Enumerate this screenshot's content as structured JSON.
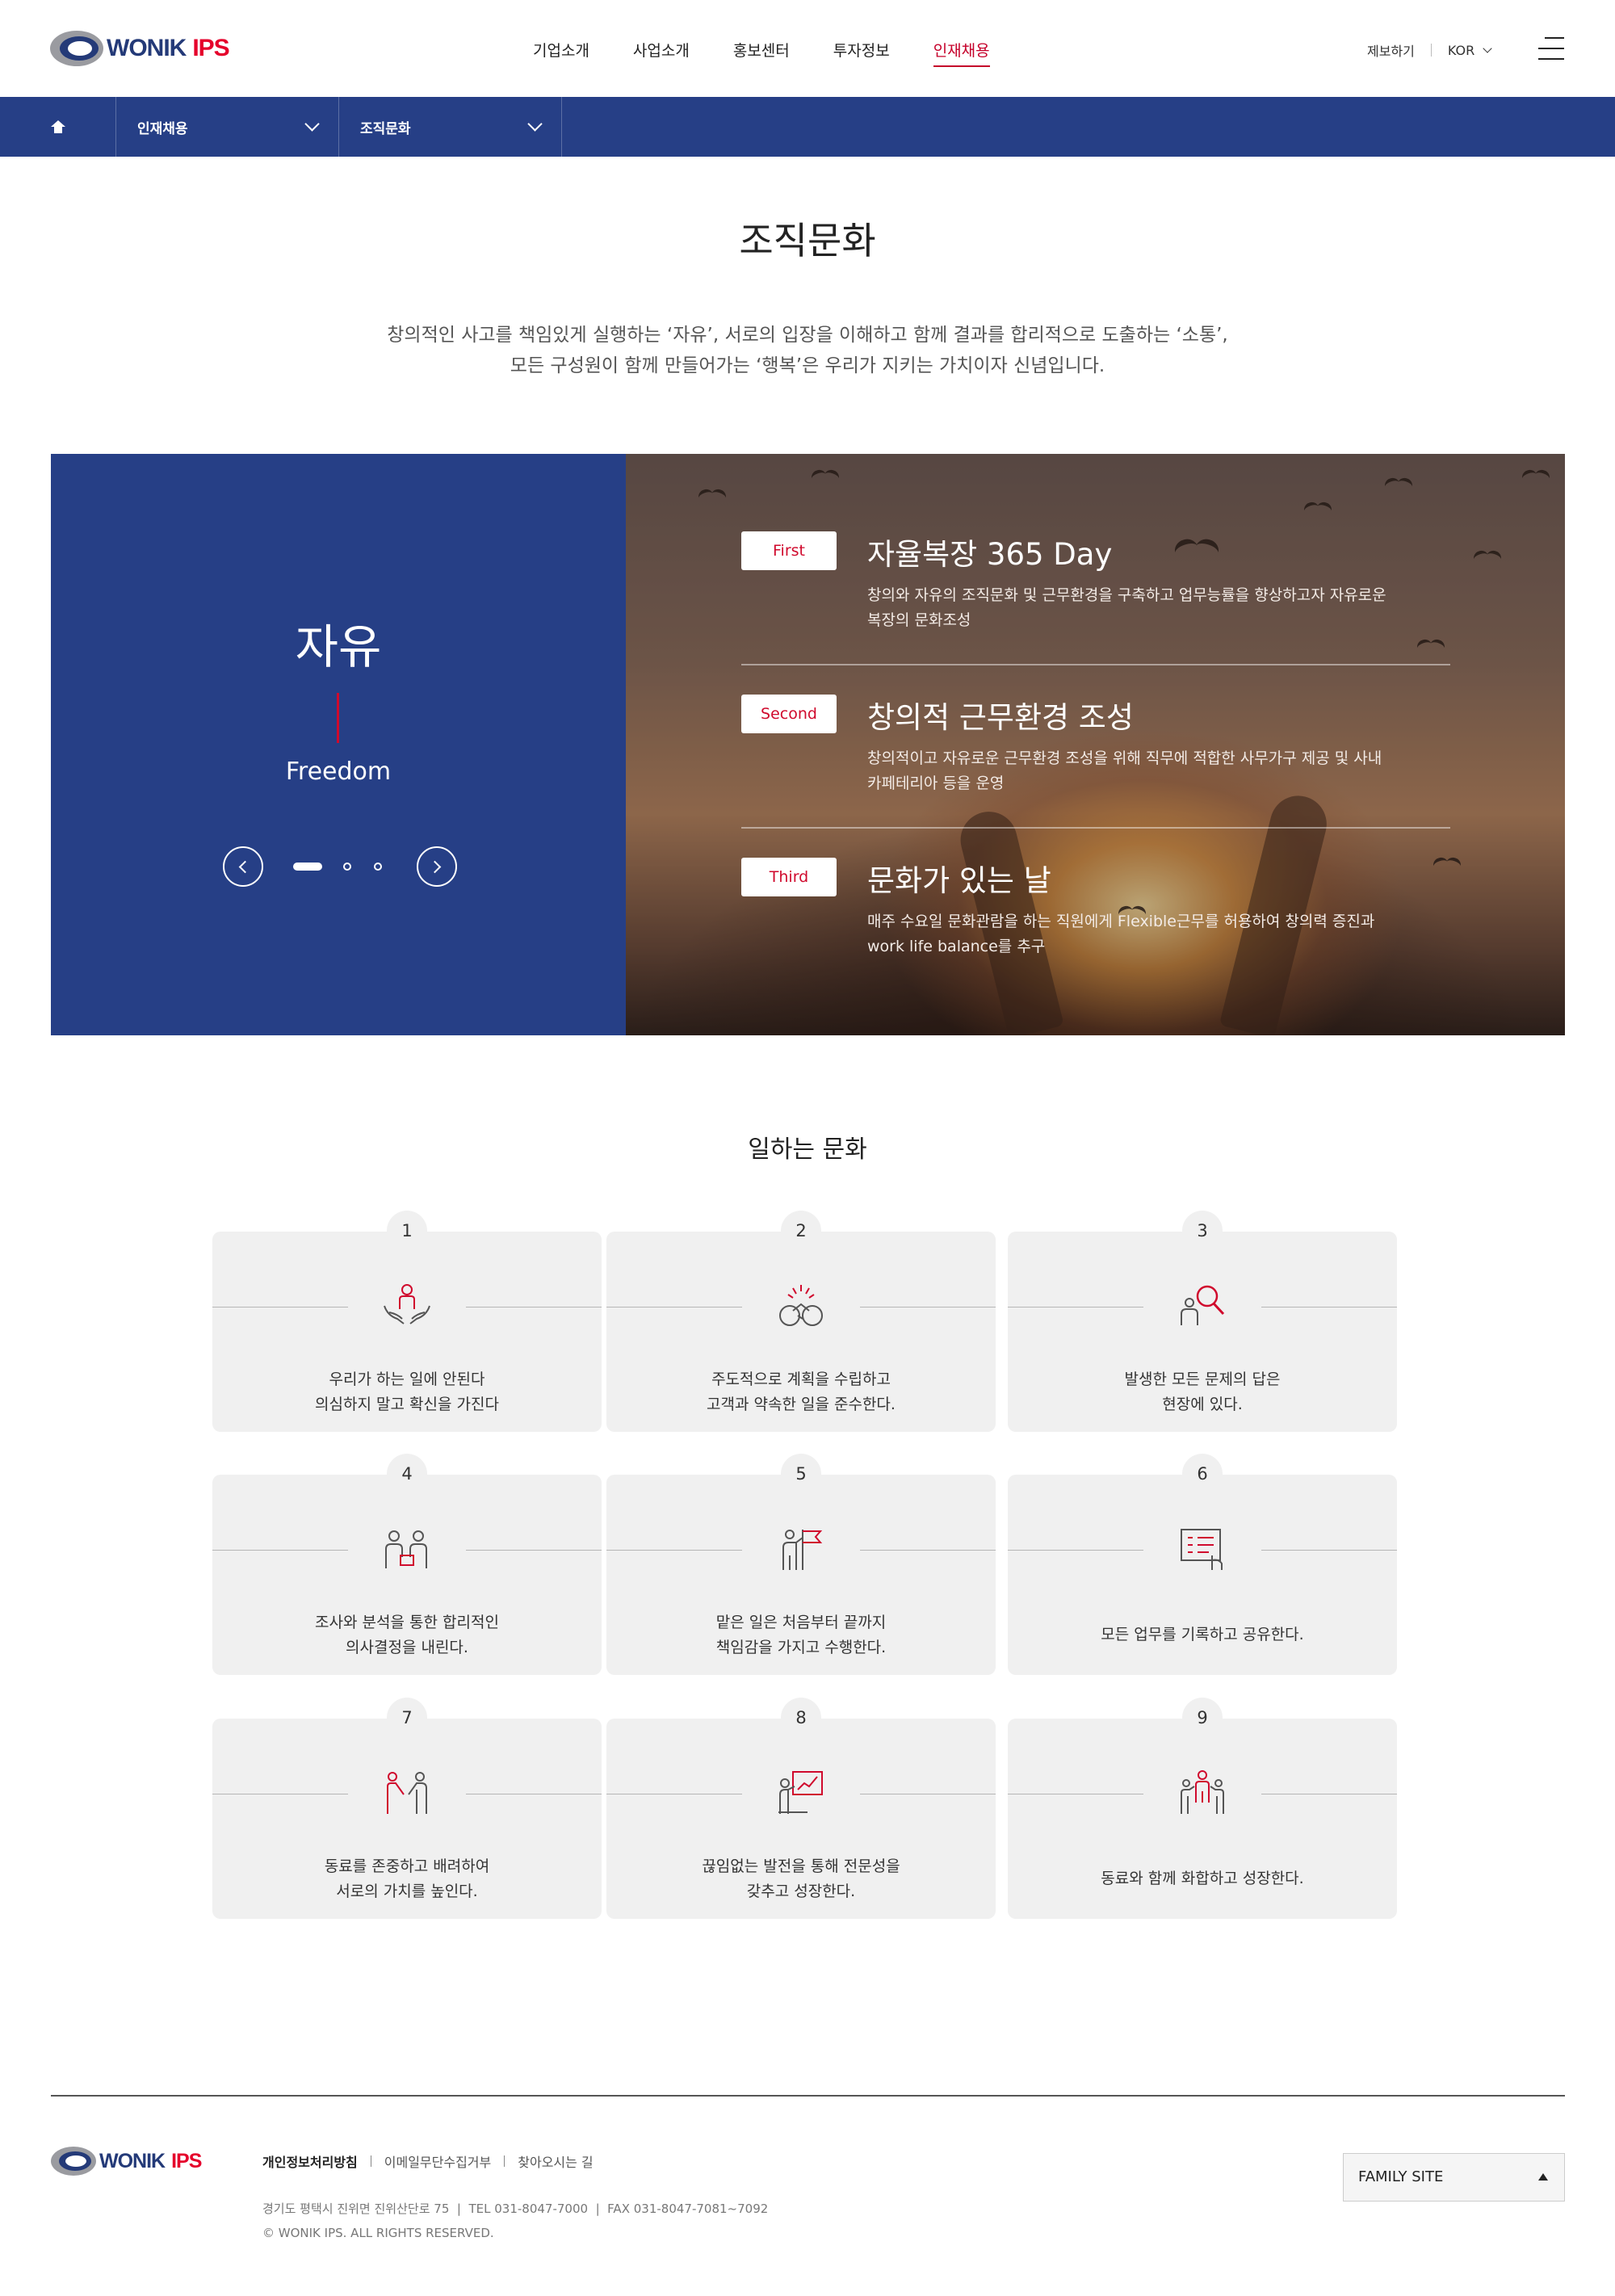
{
  "brand": {
    "logo_text_1": "WONIK",
    "logo_text_2": "IPS"
  },
  "gnb": [
    "기업소개",
    "사업소개",
    "홍보센터",
    "투자정보",
    "인재채용"
  ],
  "util": {
    "report": "제보하기",
    "lang": "KOR"
  },
  "subnav": {
    "crumb1": "인재채용",
    "crumb2": "조직문화"
  },
  "page": {
    "title": "조직문화",
    "intro_1": "창의적인 사고를 책임있게 실행하는 ‘자유’, 서로의 입장을 이해하고 함께 결과를 합리적으로 도출하는 ‘소통’,",
    "intro_2": "모든 구성원이 함께 만들어가는 ‘행복’은 우리가 지키는 가치이자 신념입니다."
  },
  "hero": {
    "word": "자유",
    "word_en": "Freedom",
    "items": [
      {
        "tag": "First",
        "title": "자율복장 365 Day",
        "desc_1": "창의와 자유의 조직문화 및 근무환경을 구축하고 업무능률을 향상하고자 자유로운",
        "desc_2": "복장의 문화조성"
      },
      {
        "tag": "Second",
        "title": "창의적 근무환경 조성",
        "desc_1": "창의적이고 자유로운 근무환경 조성을 위해 직무에 적합한 사무가구 제공 및 사내",
        "desc_2": "카페테리아 등을 운영"
      },
      {
        "tag": "Third",
        "title": "문화가 있는 날",
        "desc_1": "매주 수요일 문화관람을 하는 직원에게 Flexible근무를 허용하여 창의력 증진과",
        "desc_2": "work life balance를 추구"
      }
    ]
  },
  "culture": {
    "title": "일하는 문화",
    "cards": [
      {
        "num": "1",
        "icon": "care-hands-icon",
        "line1": "우리가 하는 일에 안된다",
        "line2": "의심하지 말고 확신을 가진다"
      },
      {
        "num": "2",
        "icon": "handshake-icon",
        "line1": "주도적으로 계획을 수립하고",
        "line2": "고객과 약속한 일을 준수한다."
      },
      {
        "num": "3",
        "icon": "magnifier-person-icon",
        "line1": "발생한 모든 문제의 답은",
        "line2": "현장에 있다."
      },
      {
        "num": "4",
        "icon": "discussion-icon",
        "line1": "조사와 분석을 통한 합리적인",
        "line2": "의사결정을 내린다."
      },
      {
        "num": "5",
        "icon": "flag-person-icon",
        "line1": "맡은 일은 처음부터 끝까지",
        "line2": "책임감을 가지고 수행한다."
      },
      {
        "num": "6",
        "icon": "checklist-icon",
        "line1": "모든 업무를 기록하고 공유한다.",
        "line2": ""
      },
      {
        "num": "7",
        "icon": "respect-icon",
        "line1": "동료를 존중하고 배려하여",
        "line2": "서로의 가치를 높인다."
      },
      {
        "num": "8",
        "icon": "growth-chart-icon",
        "line1": "끊임없는 발전을 통해 전문성을",
        "line2": "갖추고 성장한다."
      },
      {
        "num": "9",
        "icon": "team-icon",
        "line1": "동료와 함께 화합하고 성장한다.",
        "line2": ""
      }
    ]
  },
  "footer": {
    "links": [
      "개인정보처리방침",
      "이메일무단수집거부",
      "찾아오시는 길"
    ],
    "address": "경기도 평택시 진위면 진위산단로 75  |  TEL 031-8047-7000  |  FAX 031-8047-7081~7092",
    "copyright": "© WONIK IPS. ALL RIGHTS RESERVED.",
    "family_site": "FAMILY SITE"
  },
  "colors": {
    "brand_blue": "#263f86",
    "brand_red": "#d00a2d"
  }
}
